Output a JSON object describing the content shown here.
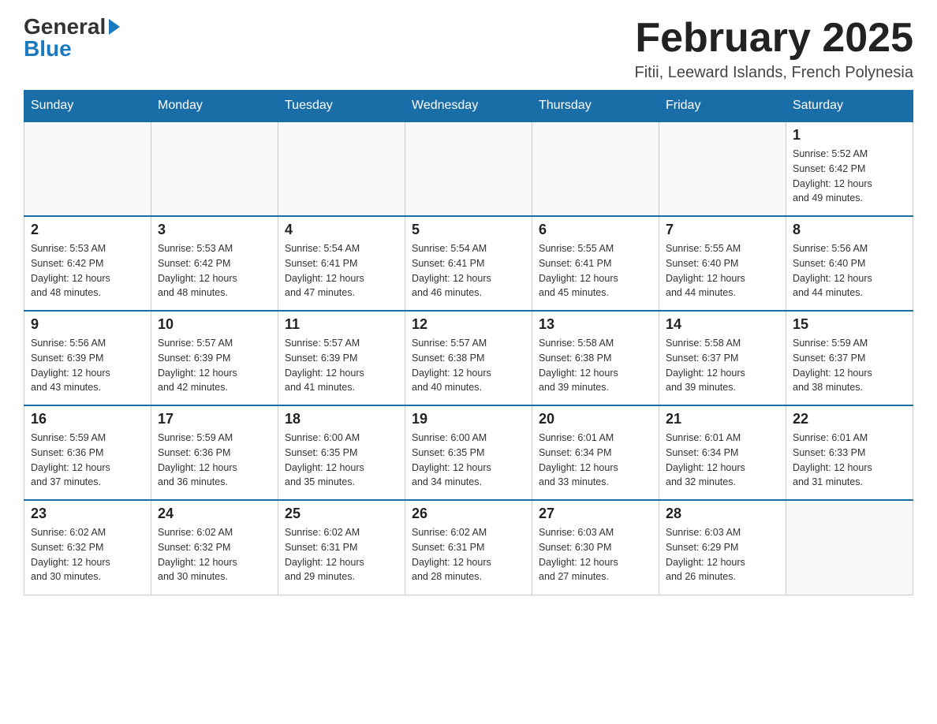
{
  "header": {
    "logo_general": "General",
    "logo_blue": "Blue",
    "month_title": "February 2025",
    "location": "Fitii, Leeward Islands, French Polynesia"
  },
  "days_of_week": [
    "Sunday",
    "Monday",
    "Tuesday",
    "Wednesday",
    "Thursday",
    "Friday",
    "Saturday"
  ],
  "weeks": [
    [
      {
        "day": "",
        "info": ""
      },
      {
        "day": "",
        "info": ""
      },
      {
        "day": "",
        "info": ""
      },
      {
        "day": "",
        "info": ""
      },
      {
        "day": "",
        "info": ""
      },
      {
        "day": "",
        "info": ""
      },
      {
        "day": "1",
        "info": "Sunrise: 5:52 AM\nSunset: 6:42 PM\nDaylight: 12 hours\nand 49 minutes."
      }
    ],
    [
      {
        "day": "2",
        "info": "Sunrise: 5:53 AM\nSunset: 6:42 PM\nDaylight: 12 hours\nand 48 minutes."
      },
      {
        "day": "3",
        "info": "Sunrise: 5:53 AM\nSunset: 6:42 PM\nDaylight: 12 hours\nand 48 minutes."
      },
      {
        "day": "4",
        "info": "Sunrise: 5:54 AM\nSunset: 6:41 PM\nDaylight: 12 hours\nand 47 minutes."
      },
      {
        "day": "5",
        "info": "Sunrise: 5:54 AM\nSunset: 6:41 PM\nDaylight: 12 hours\nand 46 minutes."
      },
      {
        "day": "6",
        "info": "Sunrise: 5:55 AM\nSunset: 6:41 PM\nDaylight: 12 hours\nand 45 minutes."
      },
      {
        "day": "7",
        "info": "Sunrise: 5:55 AM\nSunset: 6:40 PM\nDaylight: 12 hours\nand 44 minutes."
      },
      {
        "day": "8",
        "info": "Sunrise: 5:56 AM\nSunset: 6:40 PM\nDaylight: 12 hours\nand 44 minutes."
      }
    ],
    [
      {
        "day": "9",
        "info": "Sunrise: 5:56 AM\nSunset: 6:39 PM\nDaylight: 12 hours\nand 43 minutes."
      },
      {
        "day": "10",
        "info": "Sunrise: 5:57 AM\nSunset: 6:39 PM\nDaylight: 12 hours\nand 42 minutes."
      },
      {
        "day": "11",
        "info": "Sunrise: 5:57 AM\nSunset: 6:39 PM\nDaylight: 12 hours\nand 41 minutes."
      },
      {
        "day": "12",
        "info": "Sunrise: 5:57 AM\nSunset: 6:38 PM\nDaylight: 12 hours\nand 40 minutes."
      },
      {
        "day": "13",
        "info": "Sunrise: 5:58 AM\nSunset: 6:38 PM\nDaylight: 12 hours\nand 39 minutes."
      },
      {
        "day": "14",
        "info": "Sunrise: 5:58 AM\nSunset: 6:37 PM\nDaylight: 12 hours\nand 39 minutes."
      },
      {
        "day": "15",
        "info": "Sunrise: 5:59 AM\nSunset: 6:37 PM\nDaylight: 12 hours\nand 38 minutes."
      }
    ],
    [
      {
        "day": "16",
        "info": "Sunrise: 5:59 AM\nSunset: 6:36 PM\nDaylight: 12 hours\nand 37 minutes."
      },
      {
        "day": "17",
        "info": "Sunrise: 5:59 AM\nSunset: 6:36 PM\nDaylight: 12 hours\nand 36 minutes."
      },
      {
        "day": "18",
        "info": "Sunrise: 6:00 AM\nSunset: 6:35 PM\nDaylight: 12 hours\nand 35 minutes."
      },
      {
        "day": "19",
        "info": "Sunrise: 6:00 AM\nSunset: 6:35 PM\nDaylight: 12 hours\nand 34 minutes."
      },
      {
        "day": "20",
        "info": "Sunrise: 6:01 AM\nSunset: 6:34 PM\nDaylight: 12 hours\nand 33 minutes."
      },
      {
        "day": "21",
        "info": "Sunrise: 6:01 AM\nSunset: 6:34 PM\nDaylight: 12 hours\nand 32 minutes."
      },
      {
        "day": "22",
        "info": "Sunrise: 6:01 AM\nSunset: 6:33 PM\nDaylight: 12 hours\nand 31 minutes."
      }
    ],
    [
      {
        "day": "23",
        "info": "Sunrise: 6:02 AM\nSunset: 6:32 PM\nDaylight: 12 hours\nand 30 minutes."
      },
      {
        "day": "24",
        "info": "Sunrise: 6:02 AM\nSunset: 6:32 PM\nDaylight: 12 hours\nand 30 minutes."
      },
      {
        "day": "25",
        "info": "Sunrise: 6:02 AM\nSunset: 6:31 PM\nDaylight: 12 hours\nand 29 minutes."
      },
      {
        "day": "26",
        "info": "Sunrise: 6:02 AM\nSunset: 6:31 PM\nDaylight: 12 hours\nand 28 minutes."
      },
      {
        "day": "27",
        "info": "Sunrise: 6:03 AM\nSunset: 6:30 PM\nDaylight: 12 hours\nand 27 minutes."
      },
      {
        "day": "28",
        "info": "Sunrise: 6:03 AM\nSunset: 6:29 PM\nDaylight: 12 hours\nand 26 minutes."
      },
      {
        "day": "",
        "info": ""
      }
    ]
  ]
}
